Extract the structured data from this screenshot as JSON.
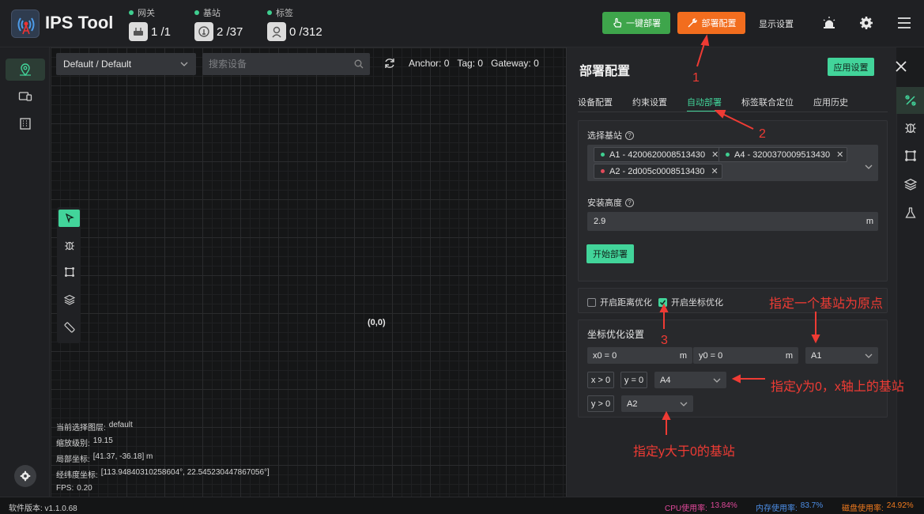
{
  "app": {
    "title": "IPS Tool"
  },
  "stats": [
    {
      "label": "网关",
      "value": "1 /1",
      "icon": "router-icon"
    },
    {
      "label": "基站",
      "value": "2 /37",
      "icon": "anchor-icon"
    },
    {
      "label": "标签",
      "value": "0 /312",
      "icon": "tag-person-icon"
    }
  ],
  "toolbar": {
    "deploy_all": "一键部署",
    "deploy_config": "部署配置",
    "display_settings": "显示设置"
  },
  "canvas": {
    "layer_select": "Default / Default",
    "search_placeholder": "搜索设备",
    "anchor_count": "Anchor: 0",
    "tag_count": "Tag: 0",
    "gateway_count": "Gateway: 0",
    "origin_label": "(0,0)",
    "info": {
      "layer_label": "当前选择图层:",
      "layer_value": "default",
      "zoom_label": "缩放级别:",
      "zoom_value": "19.15",
      "local_label": "局部坐标:",
      "local_value": "[41.37, -36.18] m",
      "lonlat_label": "经纬度坐标:",
      "lonlat_value": "[113.94840310258604°, 22.545230447867056°]",
      "fps_label": "FPS:",
      "fps_value": "0.20"
    }
  },
  "status": {
    "version": "软件版本: v1.1.0.68",
    "cpu_label": "CPU使用率:",
    "cpu_value": "13.84%",
    "mem_label": "内存使用率:",
    "mem_value": "83.7%",
    "disk_label": "磁盘使用率:",
    "disk_value": "24.92%",
    "colors": {
      "cpu": "#e0489a",
      "mem": "#4d8fe8",
      "disk": "#f07a1e"
    }
  },
  "panel": {
    "title": "部署配置",
    "apply_button": "应用设置",
    "tabs": [
      "设备配置",
      "约束设置",
      "自动部署",
      "标签联合定位",
      "应用历史"
    ],
    "active_tab": 2,
    "select_anchor_label": "选择基站",
    "chips": [
      {
        "text": "A1 - 4200620008513430",
        "color": "#3fcf90"
      },
      {
        "text": "A4 - 3200370009513430",
        "color": "#3fcf90"
      },
      {
        "text": "A2 - 2d005c0008513430",
        "color": "#e24a5a"
      }
    ],
    "height_label": "安装高度",
    "height_value": "2.9",
    "height_unit": "m",
    "start_button": "开始部署",
    "opt_distance": "开启距离优化",
    "opt_coord": "开启坐标优化",
    "coord_section_title": "坐标优化设置",
    "x0": "x0 = 0",
    "y0": "y0 = 0",
    "unit_m": "m",
    "origin_anchor": "A1",
    "cond_x": "x > 0",
    "cond_y0": "y = 0",
    "x_axis_anchor": "A4",
    "cond_y": "y > 0",
    "y_pos_anchor": "A2"
  },
  "annotations": {
    "n1": "1",
    "n2": "2",
    "n3": "3",
    "origin_note": "指定一个基站为原点",
    "xaxis_note": "指定y为0，x轴上的基站",
    "ypos_note": "指定y大于0的基站"
  },
  "accent": "#42d49a"
}
